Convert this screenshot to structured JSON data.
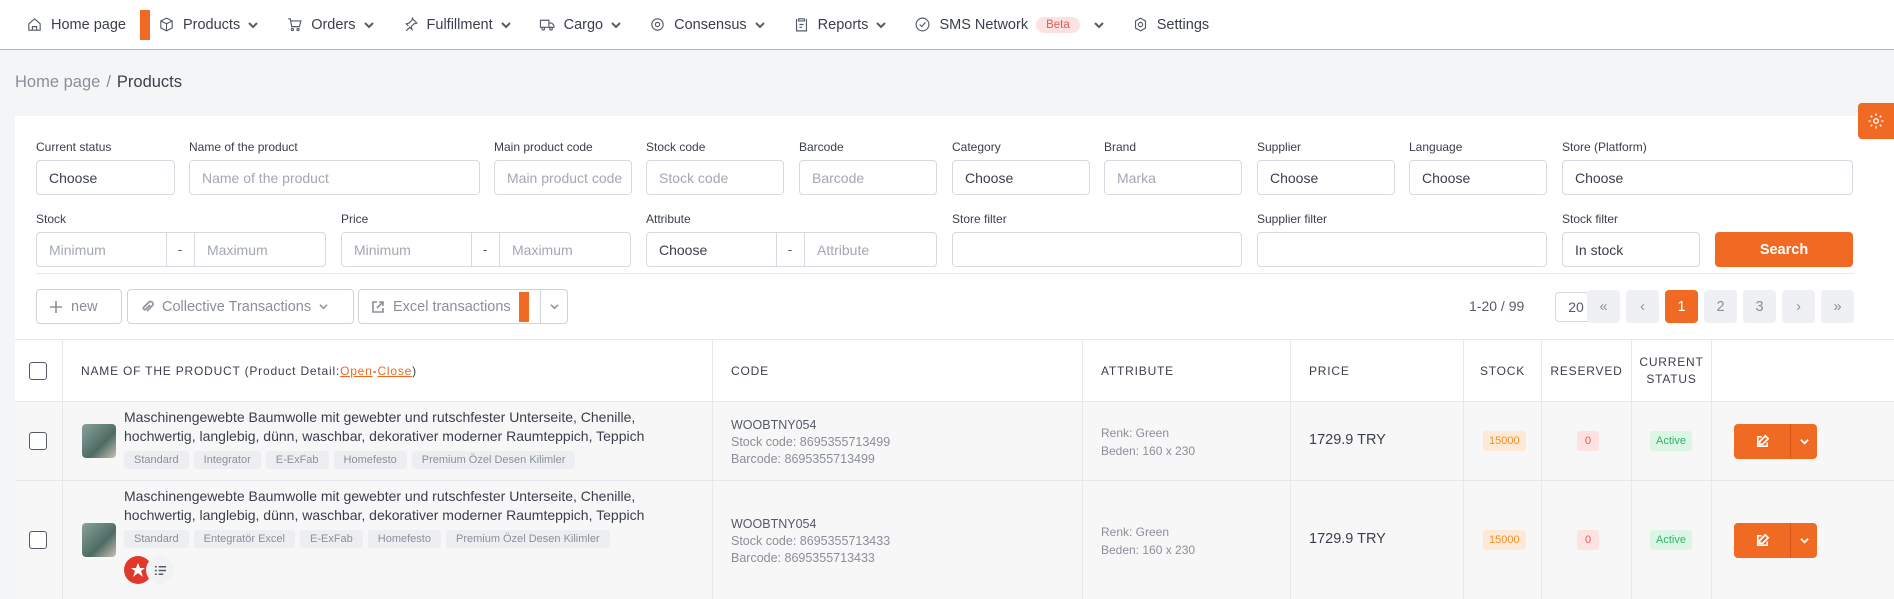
{
  "nav": {
    "items": [
      {
        "label": "Home page",
        "icon": "home-icon"
      },
      {
        "label": "Products",
        "icon": "box-icon"
      },
      {
        "label": "Orders",
        "icon": "cart-icon"
      },
      {
        "label": "Fulfillment",
        "icon": "pin-icon"
      },
      {
        "label": "Cargo",
        "icon": "truck-icon"
      },
      {
        "label": "Consensus",
        "icon": "target-icon"
      },
      {
        "label": "Reports",
        "icon": "clipboard-icon"
      },
      {
        "label": "SMS Network",
        "icon": "check-circle-icon",
        "badge": "Beta"
      },
      {
        "label": "Settings",
        "icon": "gear-icon"
      }
    ]
  },
  "breadcrumb": {
    "home": "Home page",
    "separator": "/",
    "current": "Products"
  },
  "filters": {
    "current_status": {
      "label": "Current status",
      "value": "Choose"
    },
    "product_name": {
      "label": "Name of the product",
      "placeholder": "Name of the product"
    },
    "main_code": {
      "label": "Main product code",
      "placeholder": "Main product code"
    },
    "stock_code": {
      "label": "Stock code",
      "placeholder": "Stock code"
    },
    "barcode": {
      "label": "Barcode",
      "placeholder": "Barcode"
    },
    "category": {
      "label": "Category",
      "value": "Choose"
    },
    "brand": {
      "label": "Brand",
      "placeholder": "Marka"
    },
    "supplier": {
      "label": "Supplier",
      "value": "Choose"
    },
    "language": {
      "label": "Language",
      "value": "Choose"
    },
    "store": {
      "label": "Store (Platform)",
      "value": "Choose"
    },
    "stock": {
      "label": "Stock",
      "min": "Minimum",
      "max": "Maximum",
      "sep": "-"
    },
    "price": {
      "label": "Price",
      "min": "Minimum",
      "max": "Maximum",
      "sep": "-"
    },
    "attribute": {
      "label": "Attribute",
      "value": "Choose",
      "placeholder": "Attribute",
      "sep": "-"
    },
    "store_filter": {
      "label": "Store filter",
      "value": ""
    },
    "supplier_filter": {
      "label": "Supplier filter",
      "value": ""
    },
    "stock_filter": {
      "label": "Stock filter",
      "value": "In stock"
    },
    "search_label": "Search"
  },
  "toolbar": {
    "new_label": "new",
    "collective_label": "Collective Transactions",
    "excel_label": "Excel transactions"
  },
  "pagination": {
    "range": "1-20 / 99",
    "per_page": "20",
    "first": "«",
    "prev": "‹",
    "pages": [
      "1",
      "2",
      "3"
    ],
    "active_page": "1",
    "next": "›",
    "last": "»"
  },
  "table": {
    "headers": {
      "name_prefix": "NAME OF THE PRODUCT (Product Detail: ",
      "open": "Open",
      "dash": " - ",
      "close": "Close",
      "name_suffix": ")",
      "code": "CODE",
      "attribute": "ATTRIBUTE",
      "price": "PRICE",
      "stock": "STOCK",
      "reserved": "RESERVED",
      "status_line1": "CURRENT",
      "status_line2": "STATUS"
    },
    "rows": [
      {
        "name": "Maschinengewebte Baumwolle mit gewebter und rutschfester Unterseite, Chenille, hochwertig, langlebig, dünn, waschbar, dekorativer moderner Raumteppich, Teppich",
        "tags": [
          "Standard",
          "Integrator",
          "E-ExFab",
          "Homefesto",
          "Premium Özel Desen Kilimler"
        ],
        "code": "WOOBTNY054",
        "stock_code": "Stock code: 8695355713499",
        "barcode": "Barcode: 8695355713499",
        "attr1": "Renk: Green",
        "attr2": "Beden: 160 x 230",
        "price": "1729.9 TRY",
        "stock": "15000",
        "reserved": "0",
        "status": "Active"
      },
      {
        "name": "Maschinengewebte Baumwolle mit gewebter und rutschfester Unterseite, Chenille, hochwertig, langlebig, dünn, waschbar, dekorativer moderner Raumteppich, Teppich",
        "tags": [
          "Standard",
          "Entegratör Excel",
          "E-ExFab",
          "Homefesto",
          "Premium Özel Desen Kilimler"
        ],
        "code": "WOOBTNY054",
        "stock_code": "Stock code: 8695355713433",
        "barcode": "Barcode: 8695355713433",
        "attr1": "Renk: Green",
        "attr2": "Beden: 160 x 230",
        "price": "1729.9 TRY",
        "stock": "15000",
        "reserved": "0",
        "status": "Active"
      }
    ]
  },
  "colors": {
    "accent": "#f06a24",
    "active_green": "#2fb36a",
    "reserved_red": "#e05a5a",
    "stock_orange": "#f0902a"
  }
}
